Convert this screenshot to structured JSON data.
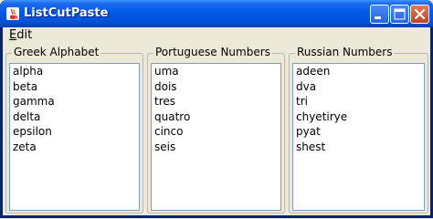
{
  "window": {
    "title": "ListCutPaste"
  },
  "menu": {
    "items": [
      {
        "label_rest": "dit",
        "mnemonic": "E"
      }
    ]
  },
  "groups": [
    {
      "title": "Greek Alphabet",
      "items": [
        "alpha",
        "beta",
        "gamma",
        "delta",
        "epsilon",
        "zeta"
      ]
    },
    {
      "title": "Portuguese Numbers",
      "items": [
        "uma",
        "dois",
        "tres",
        "quatro",
        "cinco",
        "seis"
      ]
    },
    {
      "title": "Russian Numbers",
      "items": [
        "adeen",
        "dva",
        "tri",
        "chyetirye",
        "pyat",
        "shest"
      ]
    }
  ]
}
